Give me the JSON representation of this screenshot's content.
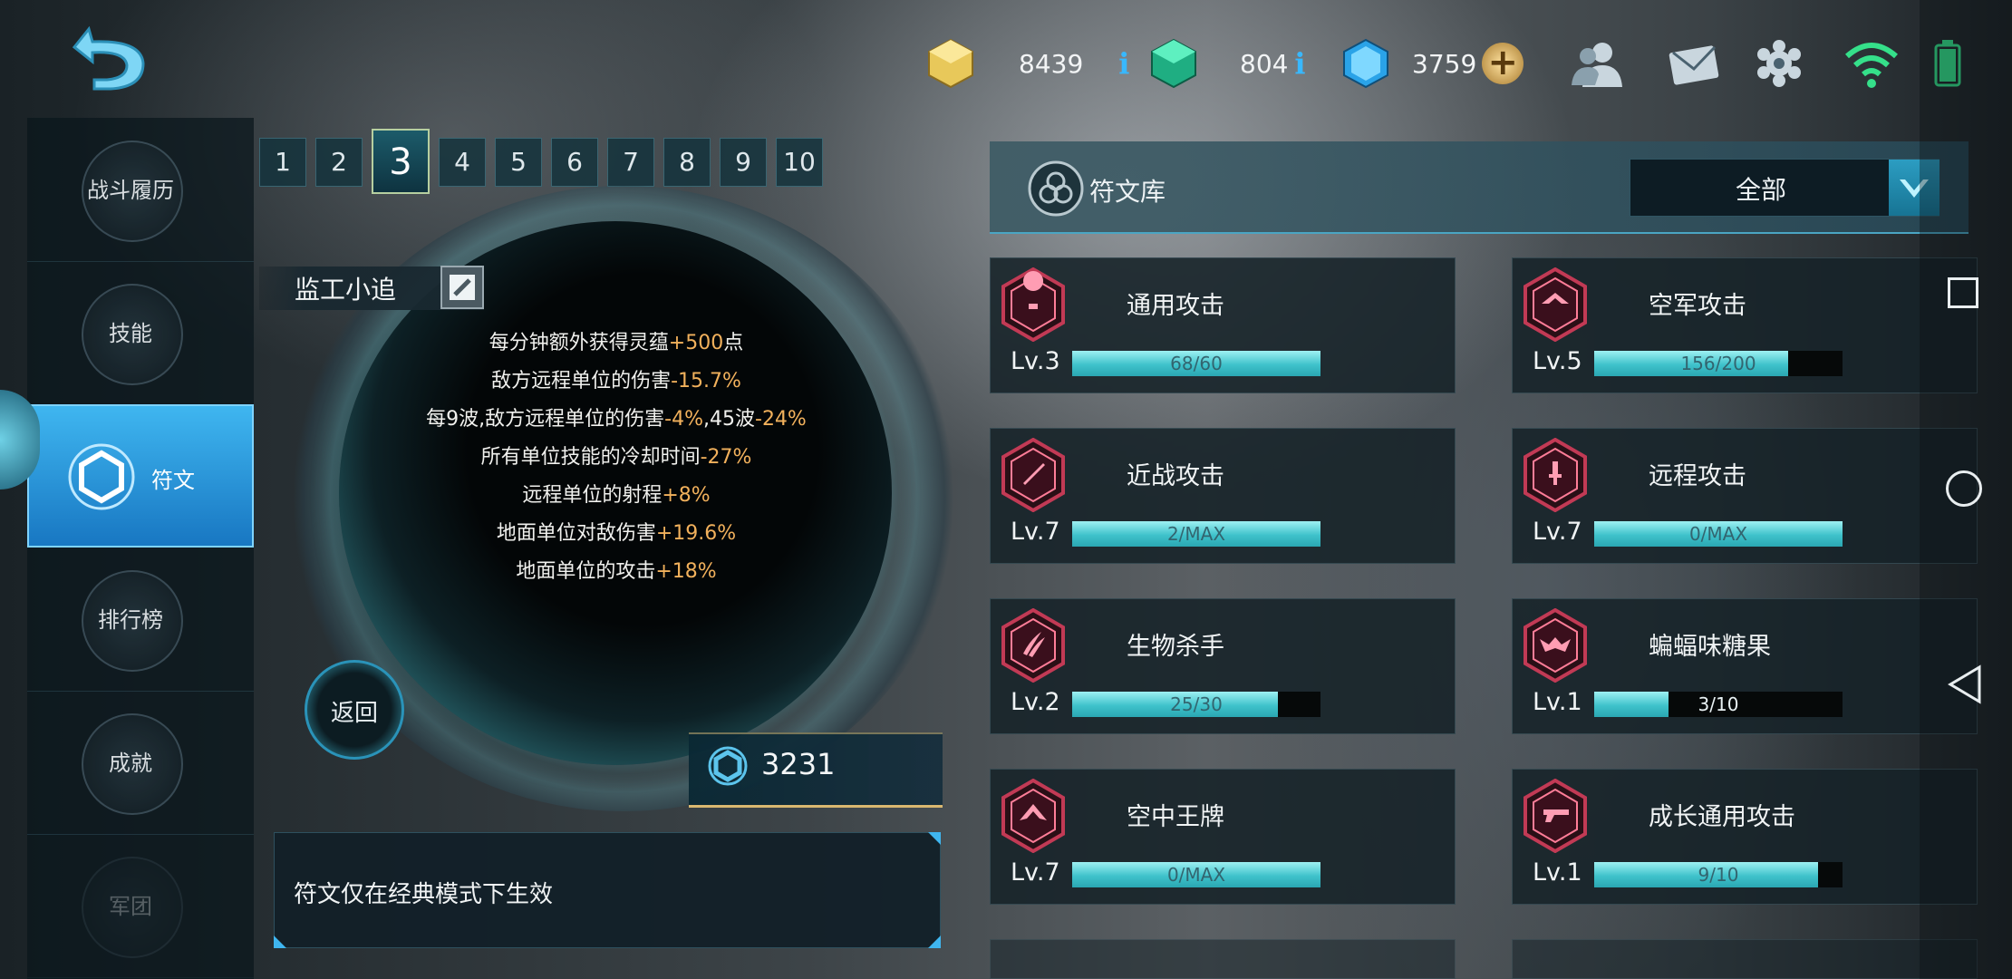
{
  "resources": {
    "gold": "8439",
    "green_gem": "804",
    "blue_gem": "3759"
  },
  "nav": {
    "items": [
      {
        "label": "战斗履历"
      },
      {
        "label": "技能"
      },
      {
        "label": "符文"
      },
      {
        "label": "排行榜"
      },
      {
        "label": "成就"
      },
      {
        "label": "军团"
      }
    ],
    "active_index": 2
  },
  "page_tabs": [
    "1",
    "2",
    "3",
    "4",
    "5",
    "6",
    "7",
    "8",
    "9",
    "10"
  ],
  "active_page": "3",
  "loadout": {
    "name": "监工小追",
    "effects": [
      {
        "text": "每分钟额外获得灵蕴",
        "value": "+500",
        "suffix": "点"
      },
      {
        "text": "敌方远程单位的伤害",
        "value": "-15.7%",
        "suffix": ""
      },
      {
        "text": "每9波,敌方远程单位的伤害",
        "value": "-4%",
        "mid": ",45波",
        "value2": "-24%"
      },
      {
        "text": "所有单位技能的冷却时间",
        "value": "-27%",
        "suffix": ""
      },
      {
        "text": "远程单位的射程",
        "value": "+8%",
        "suffix": ""
      },
      {
        "text": "地面单位对敌伤害",
        "value": "+19.6%",
        "suffix": ""
      },
      {
        "text": "地面单位的攻击",
        "value": "+18%",
        "suffix": ""
      }
    ],
    "return_label": "返回",
    "points": "3231",
    "notice": "符文仅在经典模式下生效"
  },
  "library": {
    "title": "符文库",
    "filter_value": "全部",
    "runes": [
      {
        "name": "通用攻击",
        "level": "Lv.3",
        "progress_text": "68/60",
        "progress": 1.0,
        "icon": "skull-icon"
      },
      {
        "name": "空军攻击",
        "level": "Lv.5",
        "progress_text": "156/200",
        "progress": 0.78,
        "icon": "jet-icon"
      },
      {
        "name": "近战攻击",
        "level": "Lv.7",
        "progress_text": "2/MAX",
        "progress": 1.0,
        "icon": "sword-icon"
      },
      {
        "name": "远程攻击",
        "level": "Lv.7",
        "progress_text": "0/MAX",
        "progress": 1.0,
        "icon": "dagger-icon"
      },
      {
        "name": "生物杀手",
        "level": "Lv.2",
        "progress_text": "25/30",
        "progress": 0.83,
        "icon": "claw-icon"
      },
      {
        "name": "蝙蝠味糖果",
        "level": "Lv.1",
        "progress_text": "3/10",
        "progress": 0.3,
        "icon": "bat-icon"
      },
      {
        "name": "空中王牌",
        "level": "Lv.7",
        "progress_text": "0/MAX",
        "progress": 1.0,
        "icon": "plane-icon"
      },
      {
        "name": "成长通用攻击",
        "level": "Lv.1",
        "progress_text": "9/10",
        "progress": 0.9,
        "icon": "gun-icon"
      }
    ]
  },
  "colors": {
    "accent": "#3fc2cb",
    "value_orange": "#f2b15c",
    "active_nav": "#1877c2",
    "rune_red": "#c23a55"
  }
}
